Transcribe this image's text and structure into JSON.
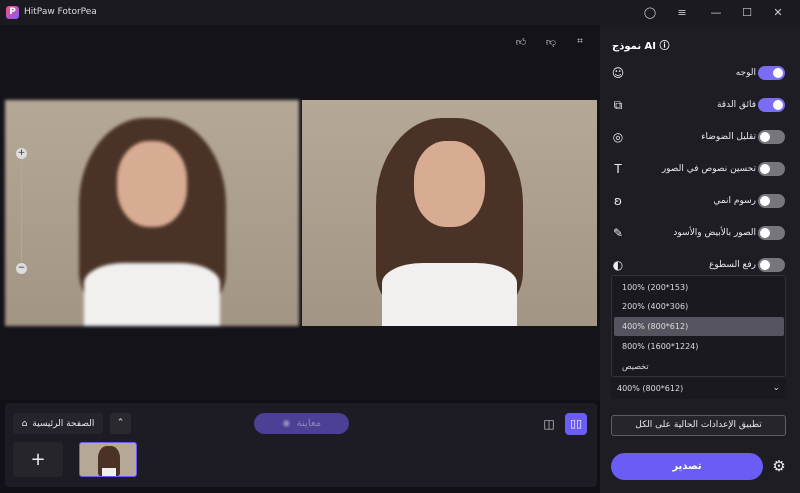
{
  "app": {
    "title": "HitPaw FotorPea",
    "logo_letter": "P"
  },
  "panel": {
    "title": "نموذج AI",
    "models": [
      {
        "label": "الوجه",
        "on": true,
        "icon": "face-icon"
      },
      {
        "label": "فائق الدقة",
        "on": true,
        "icon": "upscale-icon"
      },
      {
        "label": "تقليل الضوضاء",
        "on": false,
        "icon": "denoise-icon"
      },
      {
        "label": "تحسين نصوص في الصور",
        "on": false,
        "icon": "text-enhance-icon"
      },
      {
        "label": "رسوم انمي",
        "on": false,
        "icon": "anime-icon"
      },
      {
        "label": "الصور بالأبيض والأسود",
        "on": false,
        "icon": "colorize-icon"
      },
      {
        "label": "رفع السطوع",
        "on": false,
        "icon": "brightness-icon"
      }
    ],
    "scale_options": [
      "100% (200*153)",
      "200% (400*306)",
      "400% (800*612)",
      "800% (1600*1224)",
      "تخصيص"
    ],
    "selected_scale": "400% (800*612)",
    "apply_all": "تطبيق الإعدادات الحالية على الكل",
    "export": "تصدير"
  },
  "bottom": {
    "home": "الصفحة الرئيسية",
    "preview": "معاينة",
    "add": "+"
  }
}
